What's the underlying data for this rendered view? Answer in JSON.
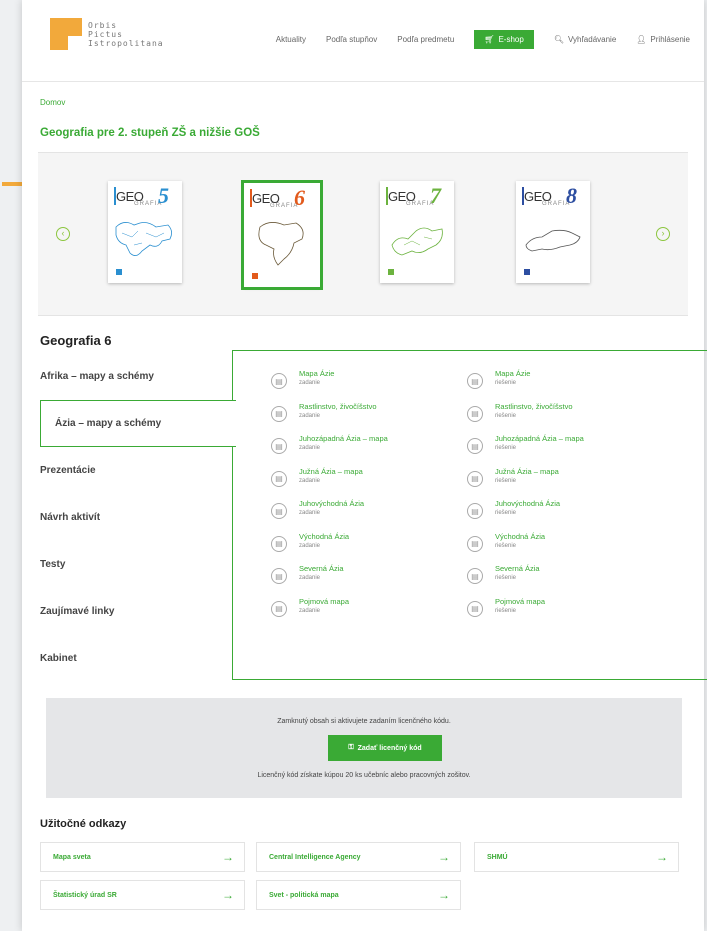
{
  "header": {
    "logo_lines": [
      "Orbis",
      "Pictus",
      "Istropolitana"
    ],
    "nav": [
      "Aktuality",
      "Podľa stupňov",
      "Podľa predmetu"
    ],
    "shop_label": "E-shop",
    "search_label": "Vyhľadávanie",
    "login_label": "Prihlásenie"
  },
  "breadcrumb": "Domov",
  "page_title": "Geografia pre 2. stupeň ZŠ a nižšie GOŠ",
  "carousel": {
    "books": [
      {
        "title": "GEO",
        "sub": "GRAFIA",
        "number": "5",
        "color": "#2a8fd0"
      },
      {
        "title": "GEO",
        "sub": "GRAFIA",
        "number": "6",
        "color": "#e25a1c"
      },
      {
        "title": "GEO",
        "sub": "GRAFIA",
        "number": "7",
        "color": "#6cb33f"
      },
      {
        "title": "GEO",
        "sub": "GRAFIA",
        "number": "8",
        "color": "#2d4ea1"
      }
    ]
  },
  "section_title": "Geografia 6",
  "tabs": [
    "Afrika – mapy a schémy",
    "Ázia – mapy a schémy",
    "Prezentácie",
    "Návrh aktivít",
    "Testy",
    "Zaujímavé linky",
    "Kabinet"
  ],
  "resources": {
    "left": [
      {
        "title": "Mapa Ázie",
        "sub": "zadanie"
      },
      {
        "title": "Rastlinstvo, živočíšstvo",
        "sub": "zadanie"
      },
      {
        "title": "Juhozápadná Ázia – mapa",
        "sub": "zadanie"
      },
      {
        "title": "Južná Ázia – mapa",
        "sub": "zadanie"
      },
      {
        "title": "Juhovýchodná Ázia",
        "sub": "zadanie"
      },
      {
        "title": "Východná Ázia",
        "sub": "zadanie"
      },
      {
        "title": "Severná Ázia",
        "sub": "zadanie"
      },
      {
        "title": "Pojmová mapa",
        "sub": "zadanie"
      }
    ],
    "right": [
      {
        "title": "Mapa Ázie",
        "sub": "riešenie"
      },
      {
        "title": "Rastlinstvo, živočíšstvo",
        "sub": "riešenie"
      },
      {
        "title": "Juhozápadná Ázia – mapa",
        "sub": "riešenie"
      },
      {
        "title": "Južná Ázia – mapa",
        "sub": "riešenie"
      },
      {
        "title": "Juhovýchodná Ázia",
        "sub": "riešenie"
      },
      {
        "title": "Východná Ázia",
        "sub": "riešenie"
      },
      {
        "title": "Severná Ázia",
        "sub": "riešenie"
      },
      {
        "title": "Pojmová mapa",
        "sub": "riešenie"
      }
    ]
  },
  "lock": {
    "text": "Zamknutý obsah si aktivujete zadaním licenčného kódu.",
    "button": "Zadať licenčný kód",
    "note": "Licenčný kód získate kúpou 20 ks učebníc alebo pracovných zošitov."
  },
  "links_title": "Užitočné odkazy",
  "links": [
    "Mapa sveta",
    "Central Intelligence Agency",
    "SHMÚ",
    "Štatistický úrad SR",
    "Svet - politická mapa"
  ],
  "colors": {
    "accent": "#3aaa35",
    "pointer": "#f2a93b"
  }
}
